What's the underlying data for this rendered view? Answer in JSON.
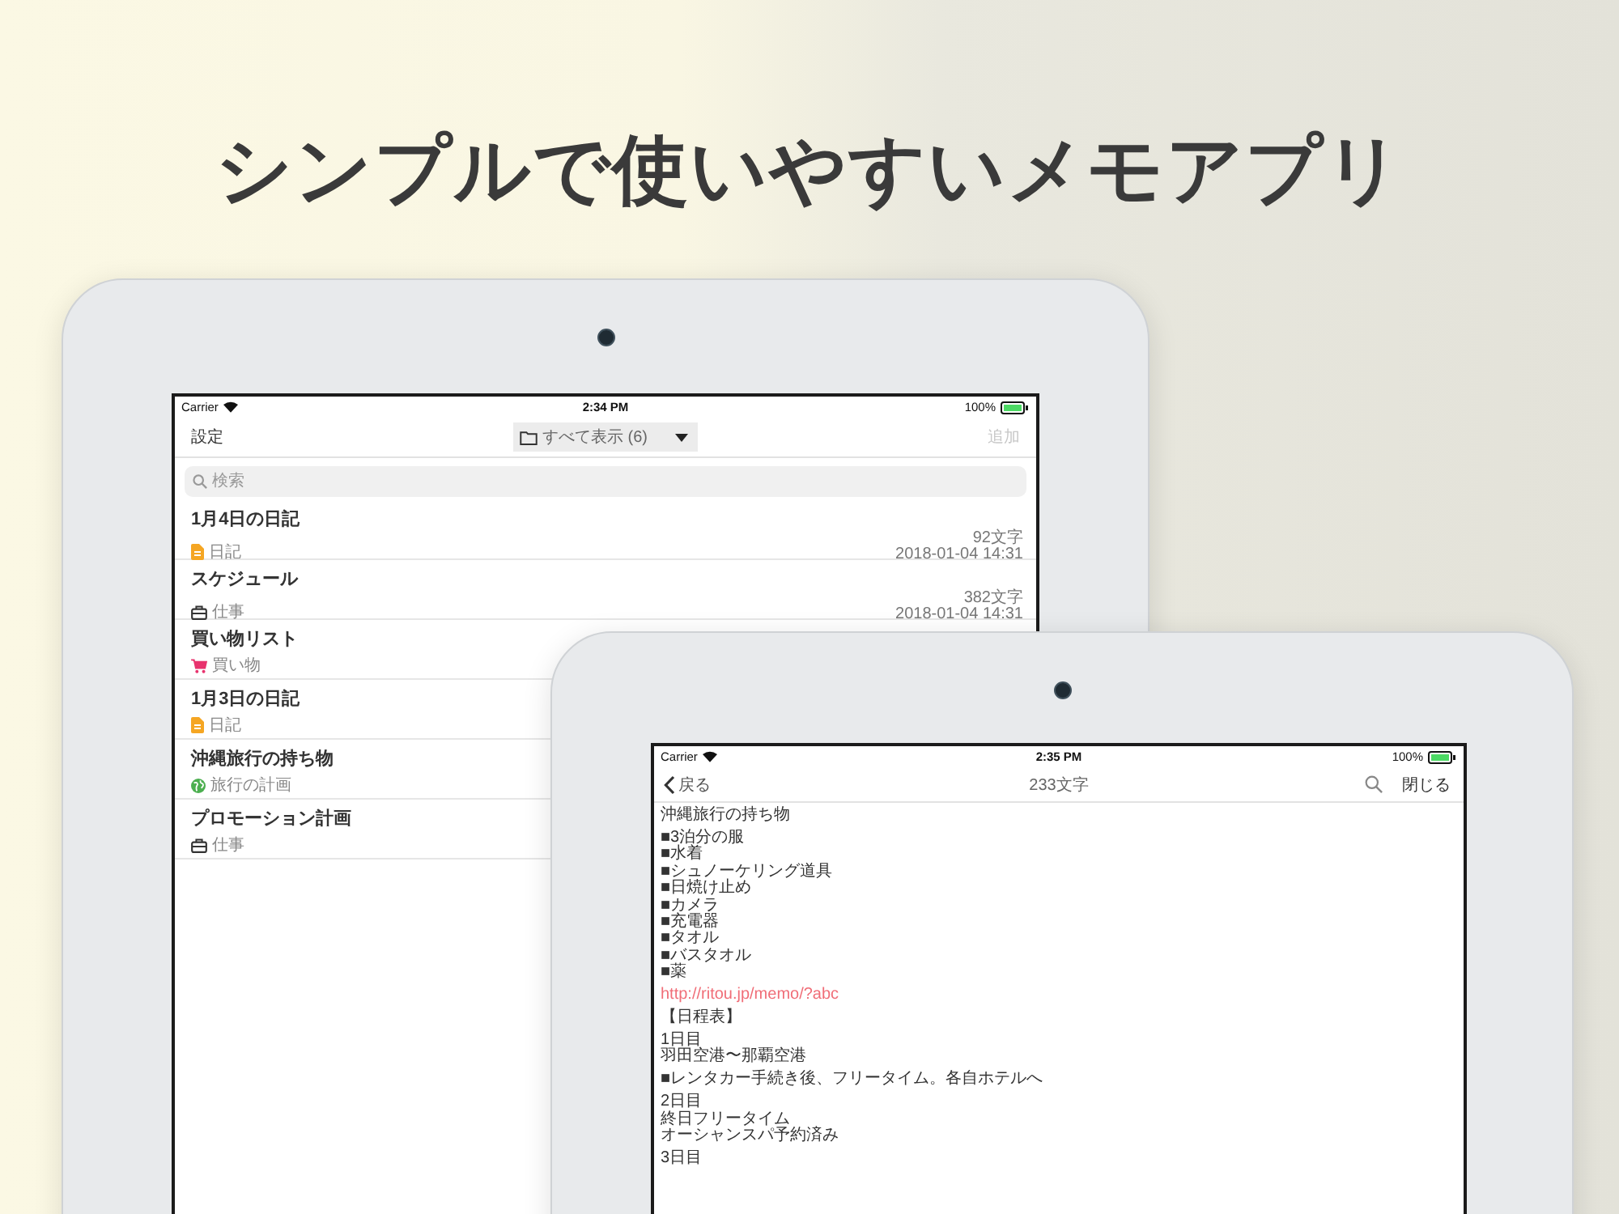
{
  "headline": "シンプルで使いやすいメモアプリ",
  "list_screen": {
    "status_bar": {
      "carrier": "Carrier",
      "time": "2:34 PM",
      "battery": "100%"
    },
    "nav": {
      "left": "設定",
      "folder": "すべて表示 (6)",
      "right": "追加",
      "right_disabled": true
    },
    "search": {
      "placeholder": "検索"
    },
    "memos": [
      {
        "title": "1月4日の日記",
        "category": "日記",
        "kind": "diary",
        "count": "92文字",
        "date": "2018-01-04 14:31"
      },
      {
        "title": "スケジュール",
        "category": "仕事",
        "kind": "work",
        "count": "382文字",
        "date": "2018-01-04 14:31"
      },
      {
        "title": "買い物リスト",
        "category": "買い物",
        "kind": "shopping"
      },
      {
        "title": "1月3日の日記",
        "category": "日記",
        "kind": "diary"
      },
      {
        "title": "沖縄旅行の持ち物",
        "category": "旅行の計画",
        "kind": "travel"
      },
      {
        "title": "プロモーション計画",
        "category": "仕事",
        "kind": "work"
      }
    ]
  },
  "detail_screen": {
    "status_bar": {
      "carrier": "Carrier",
      "time": "2:35 PM",
      "battery": "100%"
    },
    "nav": {
      "back": "戻る",
      "count": "233文字",
      "close": "閉じる"
    },
    "body": [
      {
        "kind": "text",
        "lines": [
          "沖縄旅行の持ち物"
        ]
      },
      {
        "kind": "text",
        "lines": [
          "■3泊分の服",
          "■水着",
          "■シュノーケリング道具",
          "■日焼け止め",
          "■カメラ",
          "■充電器",
          "■タオル",
          "■バスタオル",
          "■薬"
        ]
      },
      {
        "kind": "link",
        "lines": [
          "http://ritou.jp/memo/?abc"
        ]
      },
      {
        "kind": "text",
        "lines": [
          "【日程表】"
        ]
      },
      {
        "kind": "text",
        "lines": [
          "1日目",
          "羽田空港〜那覇空港"
        ]
      },
      {
        "kind": "text",
        "lines": [
          "■レンタカー手続き後、フリータイム。各自ホテルへ"
        ]
      },
      {
        "kind": "text",
        "lines": [
          "2日目",
          "終日フリータイム",
          "オーシャンスパ予約済み"
        ]
      },
      {
        "kind": "text",
        "lines": [
          "3日目"
        ]
      }
    ]
  }
}
